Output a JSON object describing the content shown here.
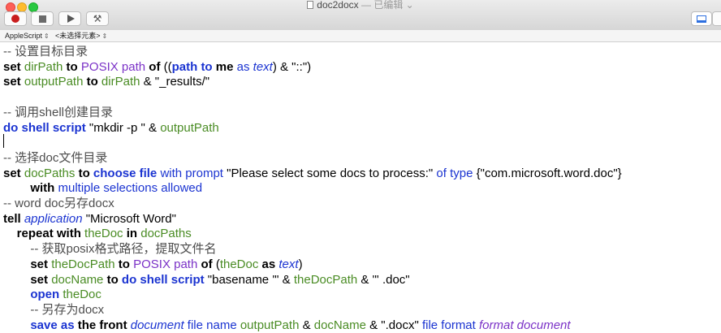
{
  "window": {
    "title": "doc2docx",
    "status": " — 已编辑 ⌄"
  },
  "toolbar": {
    "record_icon": "record-icon",
    "stop_icon": "stop-icon",
    "run_icon": "run-icon",
    "compile_icon": "hammer-icon"
  },
  "navbar": {
    "language": "AppleScript",
    "element": "<未选择元素>"
  },
  "code_lines": [
    [
      [
        "c",
        "-- 设置目标目录"
      ]
    ],
    [
      [
        "k",
        "set "
      ],
      [
        "v",
        "dirPath"
      ],
      [
        "k",
        " to "
      ],
      [
        "ad",
        "POSIX path"
      ],
      [
        "k",
        " of "
      ],
      [
        "t",
        "(("
      ],
      [
        "bk",
        "path to"
      ],
      [
        "t",
        " "
      ],
      [
        "k",
        "me"
      ],
      [
        "t",
        " "
      ],
      [
        "a",
        "as"
      ],
      [
        "t",
        " "
      ],
      [
        "cls",
        "text"
      ],
      [
        "t",
        ") & \"::\")"
      ]
    ],
    [
      [
        "k",
        "set "
      ],
      [
        "v",
        "outputPath"
      ],
      [
        "k",
        " to "
      ],
      [
        "v",
        "dirPath"
      ],
      [
        "t",
        " & \"_results/\""
      ]
    ],
    [],
    [
      [
        "c",
        "-- 调用shell创建目录"
      ]
    ],
    [
      [
        "bk",
        "do shell script"
      ],
      [
        "t",
        " \"mkdir -p \" & "
      ],
      [
        "v",
        "outputPath"
      ]
    ],
    [],
    [
      [
        "c",
        "-- 选择doc文件目录"
      ]
    ],
    [
      [
        "k",
        "set "
      ],
      [
        "v",
        "docPaths"
      ],
      [
        "k",
        " to "
      ],
      [
        "bk",
        "choose file"
      ],
      [
        "t",
        " "
      ],
      [
        "a",
        "with prompt"
      ],
      [
        "t",
        " \"Please select some docs to process:\" "
      ],
      [
        "a",
        "of type"
      ],
      [
        "t",
        " {\"com.microsoft.word.doc\"}"
      ]
    ],
    [
      [
        "t",
        "        "
      ],
      [
        "k",
        "with"
      ],
      [
        "t",
        " "
      ],
      [
        "a",
        "multiple selections allowed"
      ]
    ],
    [
      [
        "c",
        "-- word doc另存docx"
      ]
    ],
    [
      [
        "k",
        "tell "
      ],
      [
        "cls",
        "application"
      ],
      [
        "t",
        " \"Microsoft Word\""
      ]
    ],
    [
      [
        "t",
        "    "
      ],
      [
        "k",
        "repeat with "
      ],
      [
        "v",
        "theDoc"
      ],
      [
        "k",
        " in "
      ],
      [
        "v",
        "docPaths"
      ]
    ],
    [
      [
        "t",
        "        "
      ],
      [
        "c",
        "-- 获取posix格式路径，提取文件名"
      ]
    ],
    [
      [
        "t",
        "        "
      ],
      [
        "k",
        "set "
      ],
      [
        "v",
        "theDocPath"
      ],
      [
        "k",
        " to "
      ],
      [
        "ad",
        "POSIX path"
      ],
      [
        "k",
        " of "
      ],
      [
        "t",
        "("
      ],
      [
        "v",
        "theDoc"
      ],
      [
        "t",
        " "
      ],
      [
        "k",
        "as"
      ],
      [
        "t",
        " "
      ],
      [
        "cls",
        "text"
      ],
      [
        "t",
        ")"
      ]
    ],
    [
      [
        "t",
        "        "
      ],
      [
        "k",
        "set "
      ],
      [
        "v",
        "docName"
      ],
      [
        "k",
        " to "
      ],
      [
        "bk",
        "do shell script"
      ],
      [
        "t",
        " \"basename '\" & "
      ],
      [
        "v",
        "theDocPath"
      ],
      [
        "t",
        " & \"' .doc\""
      ]
    ],
    [
      [
        "t",
        "        "
      ],
      [
        "bk",
        "open"
      ],
      [
        "t",
        " "
      ],
      [
        "v",
        "theDoc"
      ]
    ],
    [
      [
        "t",
        "        "
      ],
      [
        "c",
        "-- 另存为docx"
      ]
    ],
    [
      [
        "t",
        "        "
      ],
      [
        "bk",
        "save as"
      ],
      [
        "t",
        " "
      ],
      [
        "k",
        "the front "
      ],
      [
        "cls",
        "document"
      ],
      [
        "t",
        " "
      ],
      [
        "a",
        "file name"
      ],
      [
        "t",
        " "
      ],
      [
        "v",
        "outputPath"
      ],
      [
        "t",
        " & "
      ],
      [
        "v",
        "docName"
      ],
      [
        "t",
        " & \".docx\" "
      ],
      [
        "a",
        "file format"
      ],
      [
        "t",
        " "
      ],
      [
        "pc",
        "format document"
      ]
    ]
  ]
}
